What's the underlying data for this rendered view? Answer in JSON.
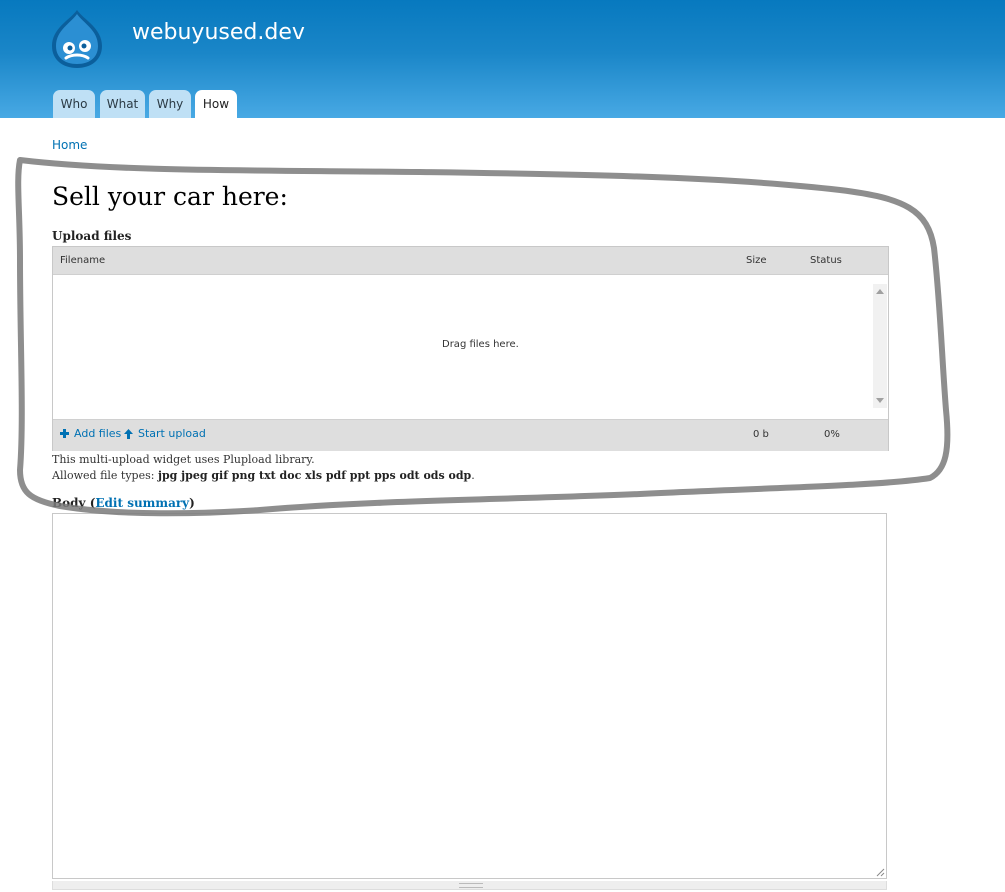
{
  "site": {
    "name": "webuyused.dev"
  },
  "nav": {
    "tabs": [
      {
        "label": "Who",
        "active": false
      },
      {
        "label": "What",
        "active": false
      },
      {
        "label": "Why",
        "active": false
      },
      {
        "label": "How",
        "active": true
      }
    ]
  },
  "breadcrumb": {
    "home": "Home"
  },
  "page": {
    "title": "Sell your car here:"
  },
  "upload": {
    "label": "Upload files",
    "columns": {
      "filename": "Filename",
      "size": "Size",
      "status": "Status"
    },
    "drop_text": "Drag files here.",
    "add_files": "Add files",
    "start_upload": "Start upload",
    "total_size": "0 b",
    "total_status": "0%",
    "description": "This multi-upload widget uses Plupload library.",
    "allowed_prefix": "Allowed file types: ",
    "allowed_types": "jpg jpeg gif png txt doc xls pdf ppt pps odt ods odp",
    "allowed_suffix": "."
  },
  "body_field": {
    "label": "Body",
    "open_paren": " (",
    "edit_summary": "Edit summary",
    "close_paren": ")",
    "value": ""
  },
  "colors": {
    "header_top": "#0779bf",
    "header_bottom": "#48a9e4",
    "link": "#0071b3",
    "annotation_stroke": "#7a7a7a"
  }
}
